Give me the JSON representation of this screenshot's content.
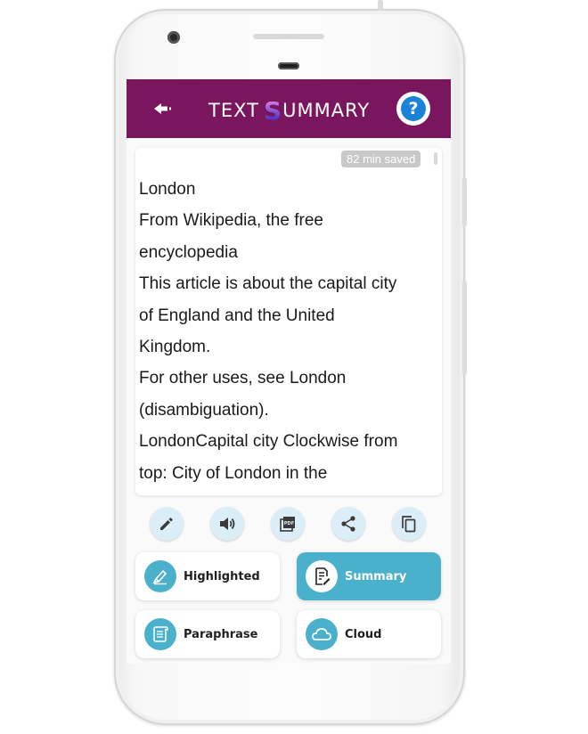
{
  "header": {
    "brand_prefix": "TEXT ",
    "brand_s": "S",
    "brand_suffix": "UMMARY",
    "help_label": "?",
    "colors": {
      "bar": "#79165e",
      "help": "#1a82d8"
    }
  },
  "icons": {
    "back": "back-arrow-icon",
    "help": "help-icon"
  },
  "document": {
    "time_saved": "82 min saved",
    "lines": [
      "London",
      "From Wikipedia, the free",
      "encyclopedia",
      "This article is about the capital city",
      "of England and the United",
      "Kingdom.",
      "For other uses, see London",
      "(disambiguation).",
      "LondonCapital city Clockwise from",
      "top: City of London in the"
    ]
  },
  "actions": [
    {
      "name": "edit",
      "icon": "pencil-icon"
    },
    {
      "name": "speak",
      "icon": "speaker-icon"
    },
    {
      "name": "pdf",
      "icon": "pdf-icon"
    },
    {
      "name": "share",
      "icon": "share-icon"
    },
    {
      "name": "copy",
      "icon": "copy-icon"
    }
  ],
  "modes": [
    {
      "label": "Highlighted",
      "icon": "highlighter-icon",
      "active": false
    },
    {
      "label": "Summary",
      "icon": "summary-doc-icon",
      "active": true
    },
    {
      "label": "Paraphrase",
      "icon": "scroll-icon",
      "active": false
    },
    {
      "label": "Cloud",
      "icon": "cloud-icon",
      "active": false
    }
  ],
  "accent_color": "#4bb0cb"
}
